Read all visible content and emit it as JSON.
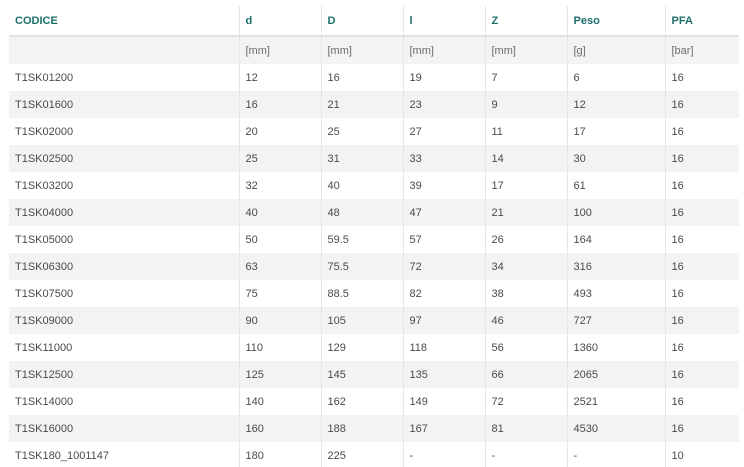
{
  "table": {
    "headers": [
      "CODICE",
      "d",
      "D",
      "l",
      "Z",
      "Peso",
      "PFA"
    ],
    "units": [
      "",
      "[mm]",
      "[mm]",
      "[mm]",
      "[mm]",
      "[g]",
      "[bar]"
    ],
    "rows": [
      [
        "T1SK01200",
        "12",
        "16",
        "19",
        "7",
        "6",
        "16"
      ],
      [
        "T1SK01600",
        "16",
        "21",
        "23",
        "9",
        "12",
        "16"
      ],
      [
        "T1SK02000",
        "20",
        "25",
        "27",
        "11",
        "17",
        "16"
      ],
      [
        "T1SK02500",
        "25",
        "31",
        "33",
        "14",
        "30",
        "16"
      ],
      [
        "T1SK03200",
        "32",
        "40",
        "39",
        "17",
        "61",
        "16"
      ],
      [
        "T1SK04000",
        "40",
        "48",
        "47",
        "21",
        "100",
        "16"
      ],
      [
        "T1SK05000",
        "50",
        "59.5",
        "57",
        "26",
        "164",
        "16"
      ],
      [
        "T1SK06300",
        "63",
        "75.5",
        "72",
        "34",
        "316",
        "16"
      ],
      [
        "T1SK07500",
        "75",
        "88.5",
        "82",
        "38",
        "493",
        "16"
      ],
      [
        "T1SK09000",
        "90",
        "105",
        "97",
        "46",
        "727",
        "16"
      ],
      [
        "T1SK11000",
        "110",
        "129",
        "118",
        "56",
        "1360",
        "16"
      ],
      [
        "T1SK12500",
        "125",
        "145",
        "135",
        "66",
        "2065",
        "16"
      ],
      [
        "T1SK14000",
        "140",
        "162",
        "149",
        "72",
        "2521",
        "16"
      ],
      [
        "T1SK16000",
        "160",
        "188",
        "167",
        "81",
        "4530",
        "16"
      ],
      [
        "T1SK180_1001147",
        "180",
        "225",
        "-",
        "-",
        "-",
        "10"
      ]
    ]
  },
  "colors": {
    "header_text": "#1a6e6a",
    "stripe": "#f3f3f3",
    "body_text": "#4a4a4a"
  }
}
